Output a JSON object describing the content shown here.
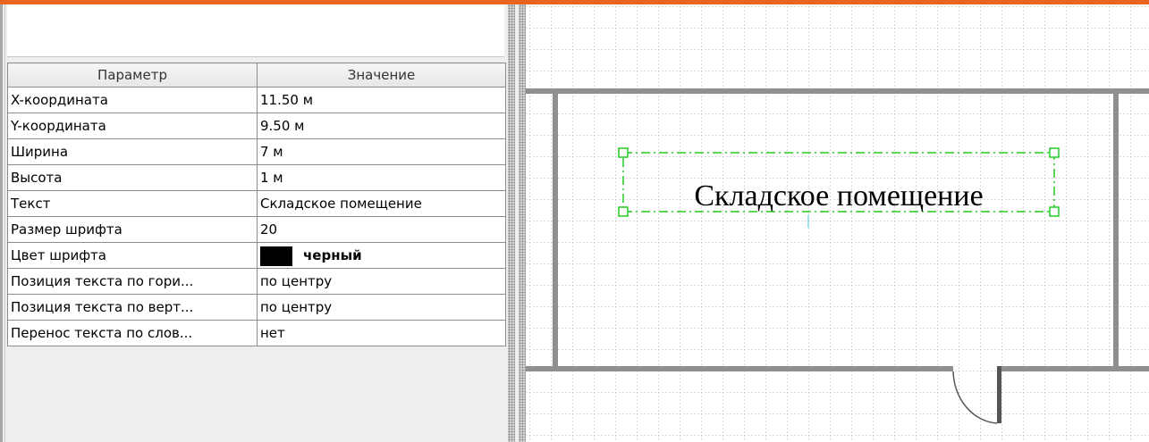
{
  "properties": {
    "header": {
      "param": "Параметр",
      "value": "Значение"
    },
    "rows": [
      {
        "param": "X-координата",
        "value": "11.50 м"
      },
      {
        "param": "Y-координата",
        "value": "9.50 м"
      },
      {
        "param": "Ширина",
        "value": "7 м"
      },
      {
        "param": "Высота",
        "value": "1 м"
      },
      {
        "param": "Текст",
        "value": "Складское помещение"
      },
      {
        "param": "Размер шрифта",
        "value": "20"
      },
      {
        "param": "Цвет шрифта",
        "value": "черный",
        "swatch": "#000000"
      },
      {
        "param": "Позиция текста по гори...",
        "value": "по центру"
      },
      {
        "param": "Позиция текста по верт...",
        "value": "по центру"
      },
      {
        "param": "Перенос текста по слов...",
        "value": "нет"
      }
    ]
  },
  "canvas": {
    "room_label": "Складское помещение",
    "grid_color": "#b4b4b4",
    "wall_color": "#8f8f8f",
    "selection_color": "#22cc22"
  },
  "colors": {
    "accent": "#e8661c"
  }
}
